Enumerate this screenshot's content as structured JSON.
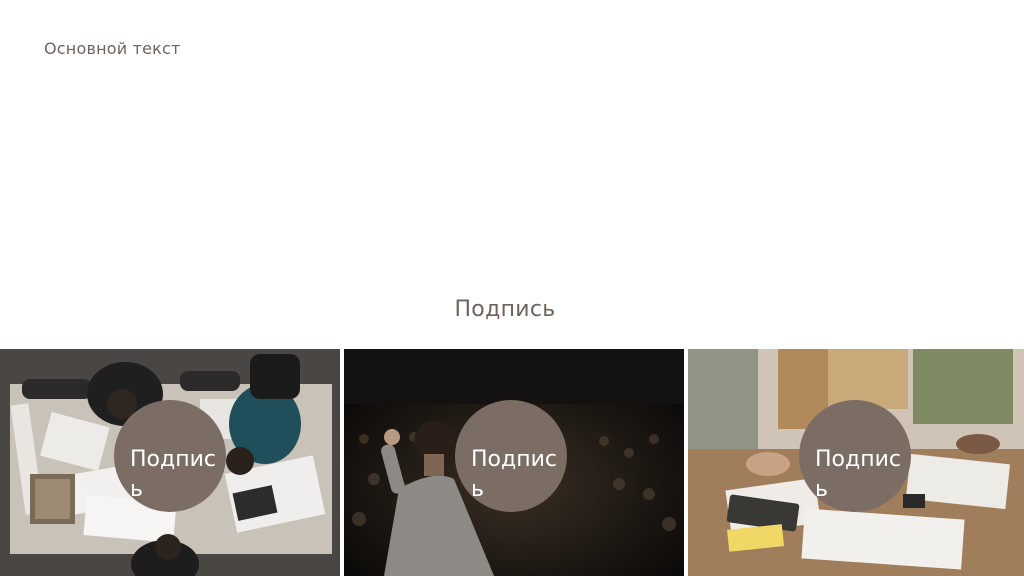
{
  "slide": {
    "body_text": "Основной текст",
    "caption": "Подпись",
    "photos": [
      {
        "name": "team-meeting-topdown-photo",
        "badge_label": "Подпись"
      },
      {
        "name": "speaker-audience-photo",
        "badge_label": "Подпись"
      },
      {
        "name": "collaboration-table-photo",
        "badge_label": "Подпись"
      }
    ]
  }
}
